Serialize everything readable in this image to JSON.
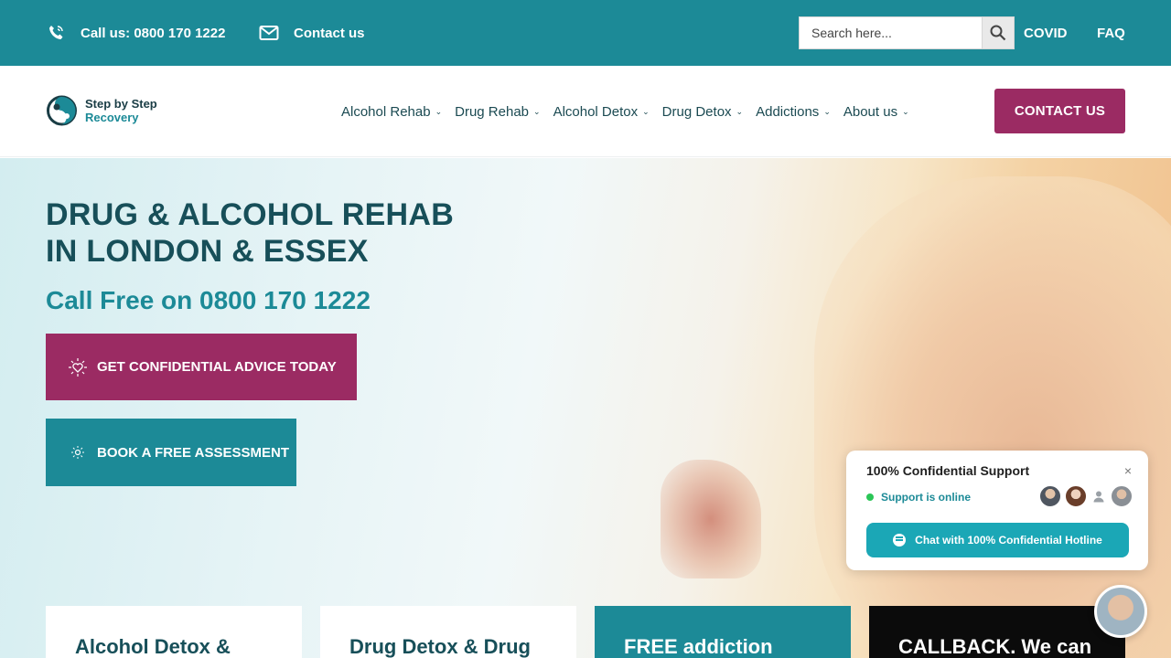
{
  "topbar": {
    "call_label": "Call us: 0800 170 1222",
    "contact_label": "Contact us",
    "search_placeholder": "Search here...",
    "covid_label": "COVID",
    "faq_label": "FAQ"
  },
  "header": {
    "logo_line1": "Step by Step",
    "logo_line2": "Recovery",
    "nav": [
      {
        "label": "Alcohol Rehab"
      },
      {
        "label": "Drug Rehab"
      },
      {
        "label": "Alcohol Detox"
      },
      {
        "label": "Drug Detox"
      },
      {
        "label": "Addictions"
      },
      {
        "label": "About us"
      }
    ],
    "cta_label": "CONTACT US"
  },
  "hero": {
    "title_line1": "DRUG & ALCOHOL REHAB",
    "title_line2": "IN LONDON & ESSEX",
    "call_free": "Call Free on 0800 170 1222",
    "btn_advice": "GET CONFIDENTIAL ADVICE TODAY",
    "btn_assessment": "BOOK A FREE ASSESSMENT"
  },
  "cards": [
    {
      "title": "Alcohol Detox &"
    },
    {
      "title": "Drug Detox & Drug"
    },
    {
      "title": "FREE addiction"
    },
    {
      "title": "CALLBACK. We can"
    }
  ],
  "chat": {
    "title": "100% Confidential Support",
    "close": "×",
    "status": "Support is online",
    "button": "Chat with 100% Confidential Hotline"
  },
  "colors": {
    "teal": "#1c8a97",
    "plum": "#9b2b63",
    "dark_teal_text": "#174f59"
  }
}
